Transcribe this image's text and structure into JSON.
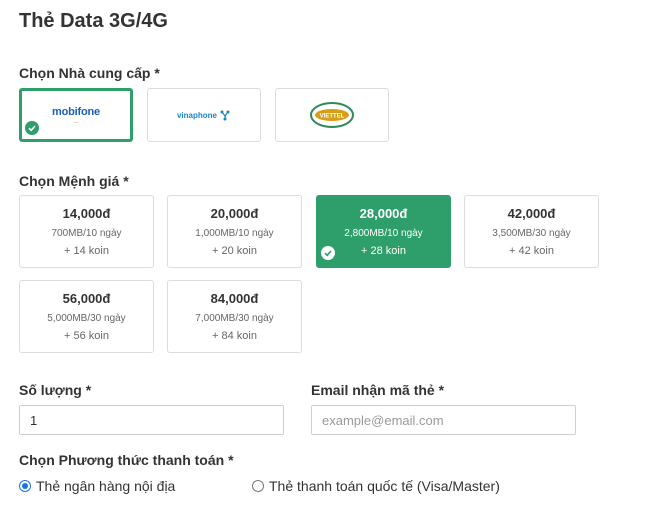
{
  "page": {
    "title": "Thẻ Data 3G/4G"
  },
  "provider_section": {
    "label": "Chọn Nhà cung cấp *",
    "providers": [
      {
        "name": "mobifone",
        "selected": true
      },
      {
        "name": "vinaphone",
        "selected": false
      },
      {
        "name": "VIETTEL",
        "selected": false
      }
    ]
  },
  "denomination_section": {
    "label": "Chọn Mệnh giá *",
    "items": [
      {
        "price": "14,000đ",
        "desc": "700MB/10 ngày",
        "koin": "+ 14 koin",
        "selected": false
      },
      {
        "price": "20,000đ",
        "desc": "1,000MB/10 ngày",
        "koin": "+ 20 koin",
        "selected": false
      },
      {
        "price": "28,000đ",
        "desc": "2,800MB/10 ngày",
        "koin": "+ 28 koin",
        "selected": true
      },
      {
        "price": "42,000đ",
        "desc": "3,500MB/30 ngày",
        "koin": "+ 42 koin",
        "selected": false
      },
      {
        "price": "56,000đ",
        "desc": "5,000MB/30 ngày",
        "koin": "+ 56 koin",
        "selected": false
      },
      {
        "price": "84,000đ",
        "desc": "7,000MB/30 ngày",
        "koin": "+ 84 koin",
        "selected": false
      }
    ]
  },
  "quantity": {
    "label": "Số lượng *",
    "value": "1"
  },
  "email": {
    "label": "Email nhận mã thẻ *",
    "placeholder": "example@email.com",
    "value": ""
  },
  "payment": {
    "label": "Chọn Phương thức thanh toán *",
    "options": [
      {
        "label": "Thẻ ngân hàng nội địa",
        "selected": true
      },
      {
        "label": "Thẻ thanh toán quốc tế (Visa/Master)",
        "selected": false
      }
    ]
  },
  "colors": {
    "accent": "#2e9e6a",
    "radio": "#1a73e8"
  }
}
